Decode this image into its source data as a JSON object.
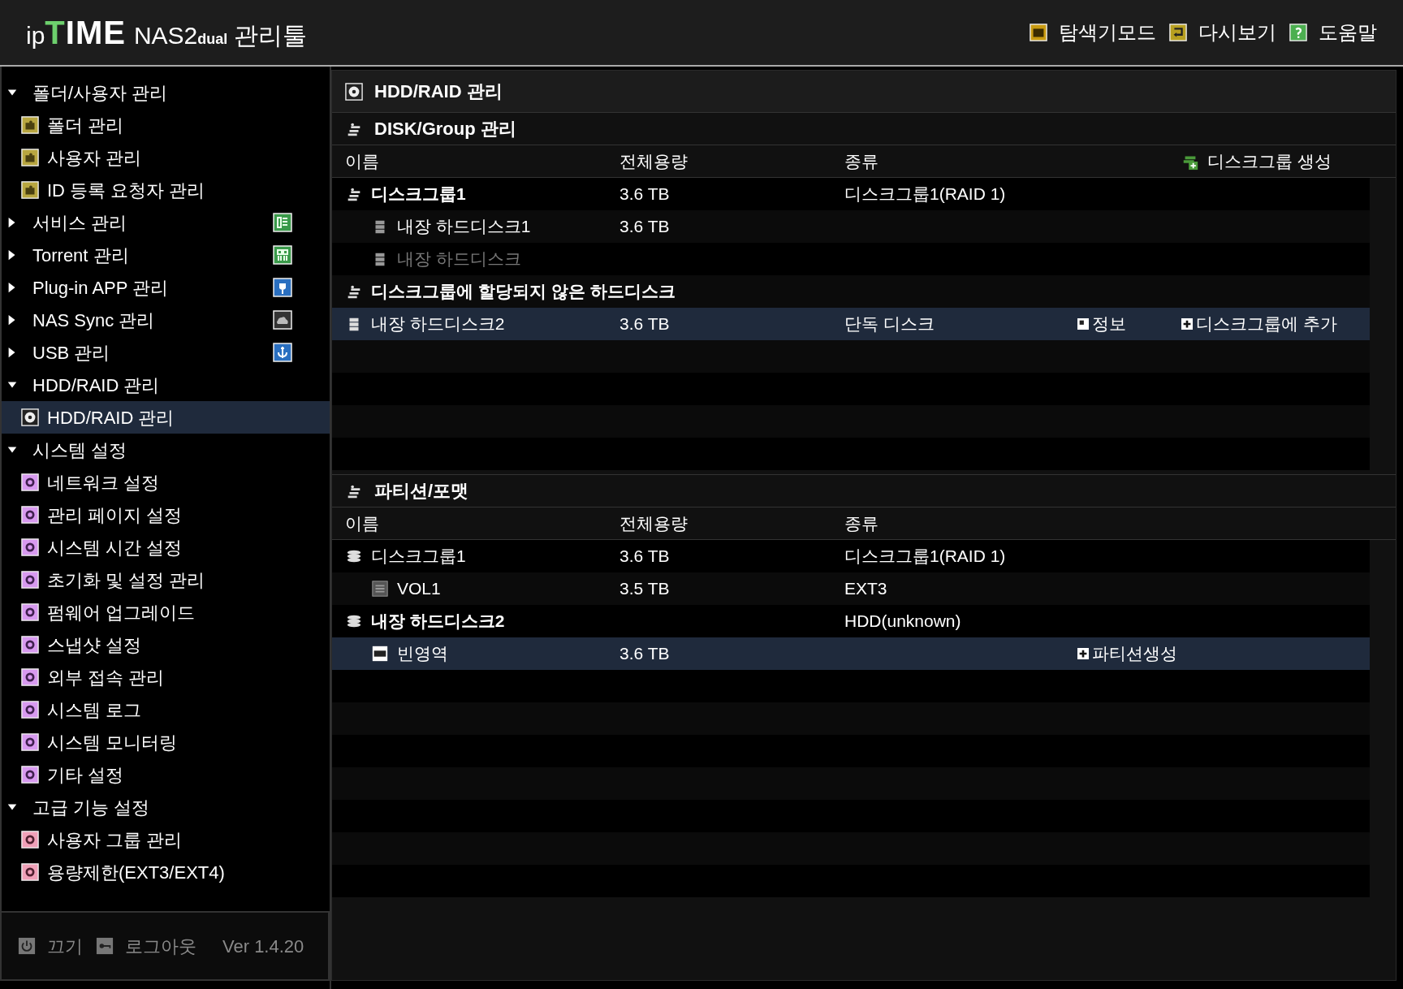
{
  "header": {
    "logo": {
      "brand_a": "ip",
      "brand_mark": "T",
      "brand_b": "IME",
      "model": "NAS2",
      "edition": "dual",
      "suffix": "관리툴"
    },
    "links": [
      {
        "kind": "explorer",
        "label": "탐색기모드"
      },
      {
        "kind": "replay",
        "label": "다시보기"
      },
      {
        "kind": "help",
        "label": "도움말"
      }
    ]
  },
  "sidebar": {
    "groups": [
      {
        "label": "폴더/사용자 관리",
        "expanded": true,
        "children": [
          {
            "kind": "folder",
            "label": "폴더 관리",
            "selected": false
          },
          {
            "kind": "folder",
            "label": "사용자 관리",
            "selected": false
          },
          {
            "kind": "folder",
            "label": "ID 등록 요청자 관리",
            "selected": false
          }
        ]
      },
      {
        "label": "서비스 관리",
        "expanded": false,
        "kind": "service"
      },
      {
        "label": "Torrent 관리",
        "expanded": false,
        "kind": "torrent"
      },
      {
        "label": "Plug-in APP 관리",
        "expanded": false,
        "kind": "plugin"
      },
      {
        "label": "NAS Sync 관리",
        "expanded": false,
        "kind": "sync"
      },
      {
        "label": "USB 관리",
        "expanded": false,
        "kind": "usb"
      },
      {
        "label": "HDD/RAID 관리",
        "expanded": true,
        "children": [
          {
            "kind": "disk",
            "label": "HDD/RAID 관리",
            "selected": true
          }
        ]
      },
      {
        "label": "시스템 설정",
        "expanded": true,
        "children": [
          {
            "kind": "system",
            "label": "네트워크 설정",
            "selected": false
          },
          {
            "kind": "system",
            "label": "관리 페이지 설정",
            "selected": false
          },
          {
            "kind": "system",
            "label": "시스템 시간 설정",
            "selected": false
          },
          {
            "kind": "system",
            "label": "초기화 및 설정 관리",
            "selected": false
          },
          {
            "kind": "system",
            "label": "펌웨어 업그레이드",
            "selected": false
          },
          {
            "kind": "system",
            "label": "스냅샷 설정",
            "selected": false
          },
          {
            "kind": "system",
            "label": "외부 접속 관리",
            "selected": false
          },
          {
            "kind": "system",
            "label": "시스템 로그",
            "selected": false
          },
          {
            "kind": "system",
            "label": "시스템 모니터링",
            "selected": false
          },
          {
            "kind": "system",
            "label": "기타 설정",
            "selected": false
          }
        ]
      },
      {
        "label": "고급 기능 설정",
        "expanded": true,
        "children": [
          {
            "kind": "advanced",
            "label": "사용자 그룹 관리",
            "selected": false
          },
          {
            "kind": "advanced",
            "label": "용량제한(EXT3/EXT4)",
            "selected": false
          }
        ]
      }
    ],
    "footer": {
      "power": "끄기",
      "logout": "로그아웃",
      "version": "Ver 1.4.20"
    }
  },
  "page_title": "HDD/RAID 관리",
  "disk_groups": {
    "title": "DISK/Group 관리",
    "columns": [
      "이름",
      "전체용량",
      "종류"
    ],
    "header_action": "디스크그룹 생성",
    "rows": [
      {
        "kind": "group",
        "name": "디스크그룹1",
        "capacity": "3.6 TB",
        "type": "디스크그룹1(RAID 1)",
        "bold": true,
        "disabled": false,
        "selected": false
      },
      {
        "kind": "member",
        "name": "내장 하드디스크1",
        "capacity": "3.6 TB",
        "bold": false,
        "disabled": false,
        "selected": false
      },
      {
        "kind": "member",
        "name": "내장 하드디스크",
        "bold": false,
        "disabled": true,
        "selected": false
      },
      {
        "kind": "group",
        "name": "디스크그룹에 할당되지 않은 하드디스크",
        "bold": true,
        "disabled": false,
        "selected": false
      },
      {
        "kind": "single",
        "name": "내장 하드디스크2",
        "capacity": "3.6 TB",
        "type": "단독 디스크",
        "info": "정보",
        "add": "디스크그룹에 추가",
        "bold": false,
        "disabled": false,
        "selected": true
      }
    ]
  },
  "partitions": {
    "title": "파티션/포맷",
    "columns": [
      "이름",
      "전체용량",
      "종류"
    ],
    "rows": [
      {
        "kind": "disk",
        "name": "디스크그룹1",
        "capacity": "3.6 TB",
        "type": "디스크그룹1(RAID 1)",
        "bold": false,
        "selected": false
      },
      {
        "kind": "volume",
        "name": "VOL1",
        "capacity": "3.5 TB",
        "type": "EXT3",
        "bold": false,
        "selected": false
      },
      {
        "kind": "disk",
        "name": "내장 하드디스크2",
        "type": "HDD(unknown)",
        "bold": true,
        "selected": false
      },
      {
        "kind": "empty",
        "name": "빈영역",
        "capacity": "3.6 TB",
        "create": "파티션생성",
        "bold": false,
        "selected": true
      }
    ]
  }
}
